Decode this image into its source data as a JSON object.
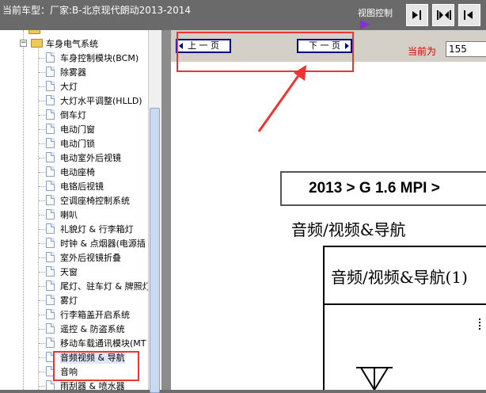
{
  "titlebar": {
    "title": "当前车型：厂家:B-北京现代朗动2013-2014",
    "view_control_label": "视图控制"
  },
  "sidebar": {
    "partial_top_label": "",
    "parent": "车身电气系统",
    "items": [
      "车身控制模块(BCM)",
      "除雾器",
      "大灯",
      "大灯水平调整(HLLD)",
      "倒车灯",
      "电动门窗",
      "电动门锁",
      "电动室外后视镜",
      "电动座椅",
      "电铬后视镜",
      "空调座椅控制系统",
      "喇叭",
      "礼貌灯 & 行李箱灯",
      "时钟 & 点烟器(电源插",
      "室外后视镜折叠",
      "天窗",
      "尾灯、驻车灯 & 牌照灯",
      "雾灯",
      "行李箱盖开启系统",
      "遥控 & 防盗系统",
      "移动车载通讯模块(MT",
      "音频视频 & 导航",
      "音响",
      "雨刮器 & 喷水器"
    ]
  },
  "toolbar": {
    "prev_page": "上 一 页",
    "next_page": "下 一 页",
    "current_page_label": "当前为",
    "current_page_value": "155"
  },
  "document": {
    "header_text": "2013 > G 1.6 MPI >",
    "section_title": "音频/视频&导航",
    "box_title": "音频/视频&导航(1)"
  },
  "colors": {
    "annotation_red": "#e33333",
    "nav_border": "#000080",
    "current_label_red": "#e00000"
  }
}
